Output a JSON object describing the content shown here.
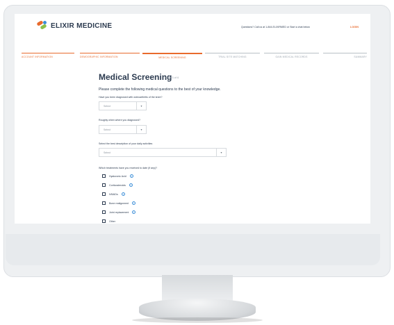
{
  "header": {
    "logo_text": "ELIXIR MEDICINE",
    "help_text": "Questions? Call us at 1-844-ELIXIRMED or Start a chat below",
    "login_label": "LOGIN"
  },
  "steps": [
    {
      "label": "ACCOUNT INFORMATION",
      "state": "complete"
    },
    {
      "label": "DEMOGRAPHIC INFORMATION",
      "state": "complete"
    },
    {
      "label": "MEDICAL SCREENING",
      "state": "active"
    },
    {
      "label": "TRIAL SITE MATCHING",
      "state": "upcoming"
    },
    {
      "label": "GAIN MEDICAL RECORDS",
      "state": "upcoming"
    },
    {
      "label": "SUMMARY",
      "state": "upcoming"
    }
  ],
  "page": {
    "title": "Medical Screening",
    "subtitle": "Step 3 of 6",
    "intro": "Please complete the following medical questions to the best of your knowledge."
  },
  "questions": [
    {
      "label": "Have you been diagnosed with osteoarthritis of the knee?",
      "value": "Select"
    },
    {
      "label": "Roughly when where you diagnosed?",
      "value": "Select"
    },
    {
      "label": "Select the best description of your daily activities",
      "value": "Select"
    }
  ],
  "treatments": {
    "question": "Which treatments have you received to date (if any)?",
    "options": [
      "Hyaluronic Acid",
      "Corticosteroids",
      "NSAIDs",
      "Bone realignment",
      "Joint replacement",
      "Other"
    ]
  },
  "colors": {
    "accent": "#e86a2c",
    "text": "#2b3a4f",
    "info": "#3b8ed8",
    "upcoming": "#9aa3ad"
  }
}
